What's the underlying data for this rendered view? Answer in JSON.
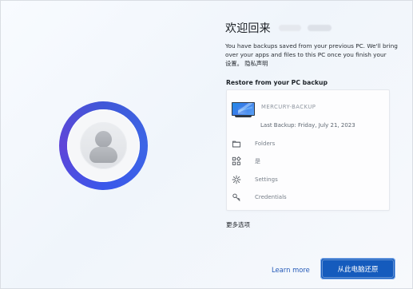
{
  "header": {
    "title": "欢迎回来"
  },
  "description": {
    "line1": "You have backups saved from your previous PC. We'll bring",
    "line2": "over your apps and files to this PC once you finish your",
    "line3_prefix": "设置。",
    "privacy_link": "隐私声明"
  },
  "restore_section": {
    "label": "Restore from your PC backup"
  },
  "backup_card": {
    "device_name": "MERCURY-BACKUP",
    "last_backup": "Last Backup: Friday, July 21, 2023",
    "items": [
      {
        "label": "Folders",
        "icon": "folder-icon"
      },
      {
        "label": "是",
        "icon": "apps-icon"
      },
      {
        "label": "Settings",
        "icon": "gear-icon"
      },
      {
        "label": "Credentials",
        "icon": "key-icon"
      }
    ]
  },
  "options": {
    "more_label": "更多选项"
  },
  "actions": {
    "learn_more": "Learn more",
    "restore_button": "从此电脑还原"
  },
  "colors": {
    "ring_blue": "#3a57ea",
    "button_blue": "#155bbd",
    "link_blue": "#245ab8"
  }
}
